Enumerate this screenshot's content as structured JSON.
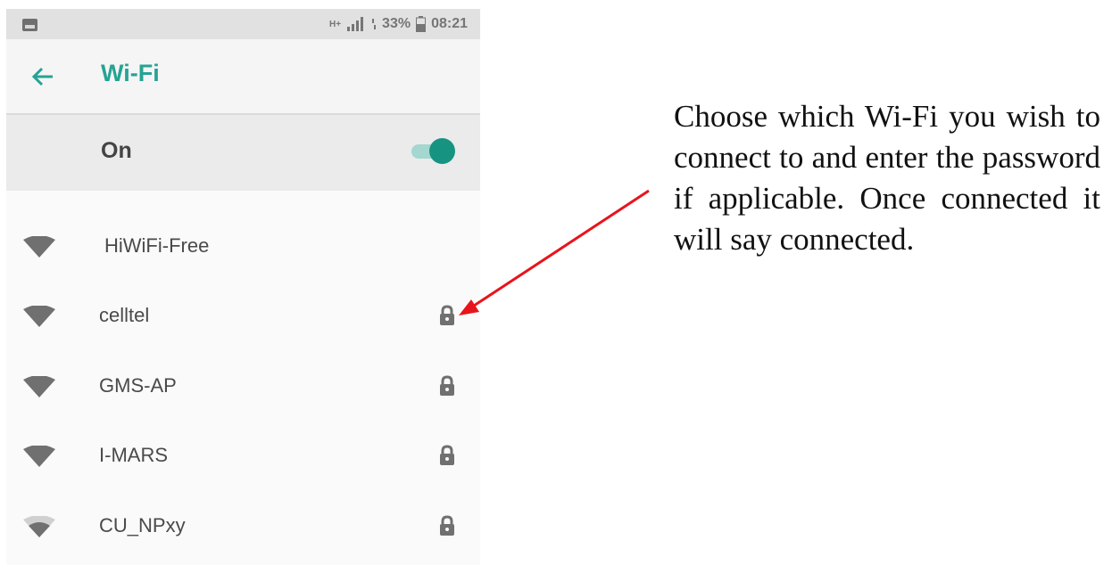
{
  "status_bar": {
    "network_type": "H+",
    "battery_percent": "33%",
    "time": "08:21",
    "icons": [
      "image-notification-icon",
      "signal-icon",
      "data-arrows-icon",
      "battery-icon"
    ]
  },
  "app_bar": {
    "back_icon": "arrow-left-icon",
    "title": "Wi-Fi"
  },
  "wifi_toggle": {
    "label": "On",
    "enabled": true
  },
  "networks": [
    {
      "name": "HiWiFi-Free",
      "secured": false,
      "signal": "full"
    },
    {
      "name": "celltel",
      "secured": true,
      "signal": "full"
    },
    {
      "name": "GMS-AP",
      "secured": true,
      "signal": "full"
    },
    {
      "name": "I-MARS",
      "secured": true,
      "signal": "full"
    },
    {
      "name": "CU_NPxy",
      "secured": true,
      "signal": "partial"
    }
  ],
  "annotation": {
    "text": "Choose which Wi-Fi you wish to connect to and enter the password if applicable. Once connected it will say connected.",
    "arrow_color": "#e8141b"
  },
  "colors": {
    "accent": "#26a394",
    "switch_thumb": "#169481",
    "switch_track": "#a3d7d0",
    "icon_gray": "#707070"
  }
}
